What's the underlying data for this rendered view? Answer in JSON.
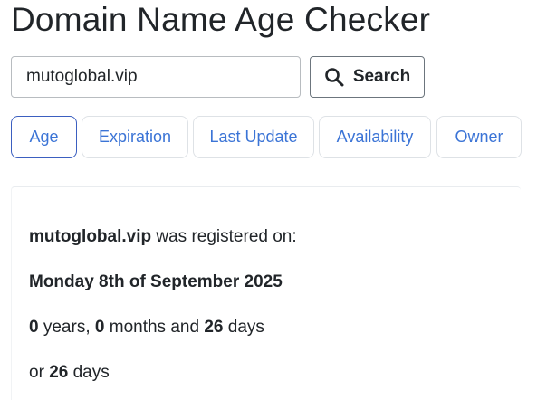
{
  "header": {
    "title": "Domain Name Age Checker"
  },
  "search": {
    "value": "mutoglobal.vip",
    "placeholder": "",
    "button_label": "Search",
    "button_icon": "search-icon"
  },
  "tabs": [
    {
      "label": "Age",
      "active": true
    },
    {
      "label": "Expiration",
      "active": false
    },
    {
      "label": "Last Update",
      "active": false
    },
    {
      "label": "Availability",
      "active": false
    },
    {
      "label": "Owner",
      "active": false
    }
  ],
  "result": {
    "domain": "mutoglobal.vip",
    "registered_text": "was registered on:",
    "date": "Monday 8th of September 2025",
    "years": "0",
    "years_label": "years,",
    "months": "0",
    "months_label": "months and",
    "days": "26",
    "days_label": "days",
    "or_label": "or",
    "total_days": "26",
    "total_days_label": "days"
  },
  "colors": {
    "tab_text": "#3b74d6",
    "tab_active_border": "#3b5fc0",
    "text": "#212529"
  }
}
